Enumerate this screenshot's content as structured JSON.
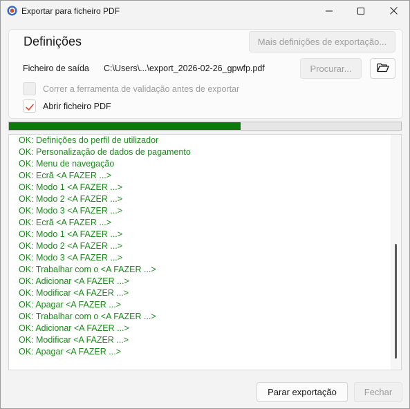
{
  "window": {
    "title": "Exportar para ficheiro PDF"
  },
  "settings": {
    "title": "Definições",
    "more_button": "Mais definições de exportação...",
    "output_label": "Ficheiro de saída",
    "output_path": "C:\\Users\\...\\export_2026-02-26_gpwfp.pdf",
    "browse_button": "Procurar...",
    "validate_label": "Correr a ferramenta de validação antes de exportar",
    "validate_checked": false,
    "validate_enabled": false,
    "open_pdf_label": "Abrir ficheiro PDF",
    "open_pdf_checked": true
  },
  "progress": {
    "fraction": 0.59,
    "color": "#0a7a0a"
  },
  "log": {
    "color": "#1a8a1a",
    "lines": [
      "OK: Definições do perfil de utilizador",
      "OK: Personalização de dados de pagamento",
      "OK: Menu de navegação",
      "OK: Ecrã <A FAZER ...>",
      "OK: Modo 1 <A FAZER ...>",
      "OK: Modo 2 <A FAZER ...>",
      "OK: Modo 3 <A FAZER ...>",
      "OK: Ecrã <A FAZER ...>",
      "OK: Modo 1 <A FAZER ...>",
      "OK: Modo 2 <A FAZER ...>",
      "OK: Modo 3 <A FAZER ...>",
      "OK: Trabalhar com o <A FAZER ...>",
      "OK: Adicionar <A FAZER ...>",
      "OK: Modificar <A FAZER ...>",
      "OK: Apagar <A FAZER ...>",
      "OK: Trabalhar com o <A FAZER ...>",
      "OK: Adicionar <A FAZER ...>",
      "OK: Modificar <A FAZER ...>",
      "OK: Apagar <A FAZER ...>"
    ]
  },
  "footer": {
    "stop_button": "Parar exportação",
    "close_button": "Fechar",
    "close_enabled": false
  },
  "icons": {
    "app": "app-logo-icon",
    "minimize": "minimize-icon",
    "maximize": "maximize-icon",
    "close": "close-icon",
    "folder": "folder-open-icon",
    "check": "checkmark-icon"
  }
}
